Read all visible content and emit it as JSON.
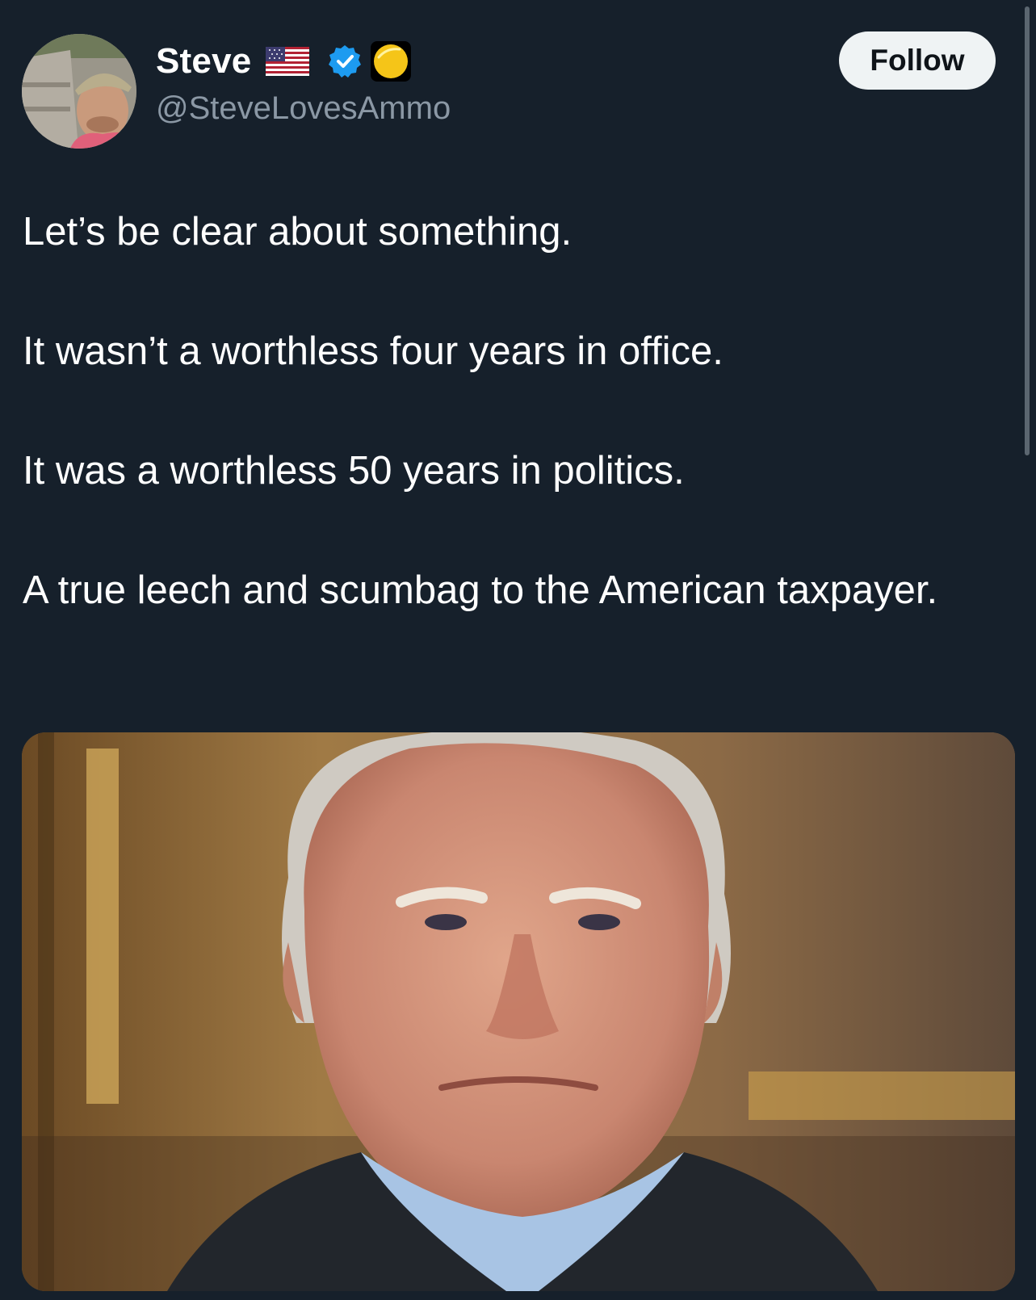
{
  "author": {
    "display_name": "Steve",
    "handle": "@SteveLovesAmmo",
    "flag_icon": "us-flag-icon",
    "verified_icon": "verified-badge-icon",
    "affiliate_icon": "yellow-circle-badge-icon"
  },
  "follow_button": {
    "label": "Follow"
  },
  "post": {
    "paragraphs": [
      "Let’s be clear about something.",
      "It wasn’t a worthless four years in office.",
      "It was a worthless 50 years in politics.",
      "A true leech and scumbag to the American taxpayer."
    ]
  },
  "colors": {
    "background": "#16202b",
    "text_primary": "#ffffff",
    "text_secondary": "#8b98a5",
    "verified_blue": "#1d9bf0",
    "follow_button_bg": "#eff3f4"
  }
}
